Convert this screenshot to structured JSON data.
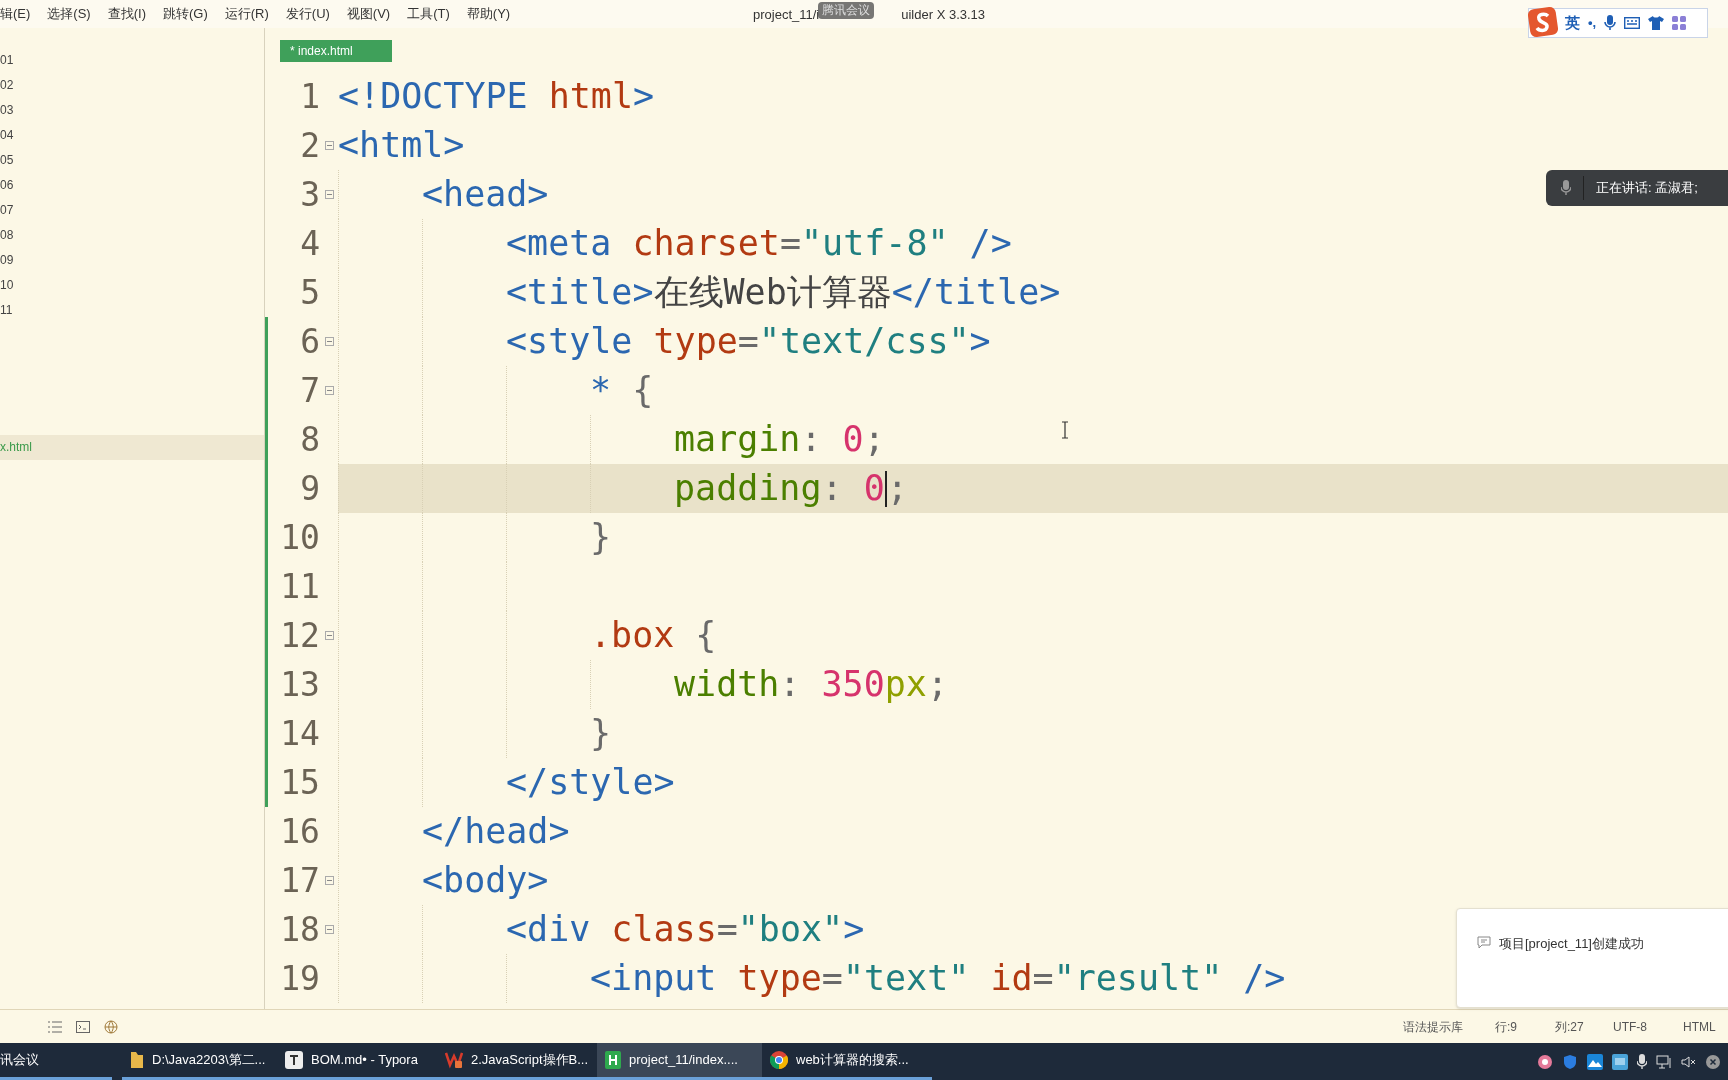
{
  "menu": [
    "辑(E)",
    "选择(S)",
    "查找(I)",
    "跳转(G)",
    "运行(R)",
    "发行(U)",
    "视图(V)",
    "工具(T)",
    "帮助(Y)"
  ],
  "window": {
    "title_start": "project_11/i",
    "title_end": "uilder X 3.3.13",
    "overlay": "腾讯会议"
  },
  "ime_bar": {
    "mode": "英",
    "punct": "•,"
  },
  "sidebar": {
    "items": [
      {
        "label": "01",
        "selected": false
      },
      {
        "label": "02",
        "selected": false
      },
      {
        "label": "03",
        "selected": false
      },
      {
        "label": "04",
        "selected": false
      },
      {
        "label": "05",
        "selected": false
      },
      {
        "label": "06",
        "selected": false
      },
      {
        "label": "07",
        "selected": false
      },
      {
        "label": "08",
        "selected": false
      },
      {
        "label": "09",
        "selected": false
      },
      {
        "label": "10",
        "selected": false
      },
      {
        "label": "11",
        "selected": false
      }
    ],
    "file": {
      "label": "x.html",
      "selected": true
    }
  },
  "tabs": [
    {
      "label": "* index.html",
      "selected": true
    }
  ],
  "speaking": "正在讲话: 孟淑君;",
  "editor": {
    "lines": [
      {
        "n": "1",
        "fold": false,
        "changed": false,
        "current": false,
        "tokens": [
          {
            "t": "<!DOCTYPE ",
            "kind": "tag"
          },
          {
            "t": "html",
            "kind": "attr"
          },
          {
            "t": ">",
            "kind": "tag"
          }
        ]
      },
      {
        "n": "2",
        "fold": true,
        "changed": false,
        "current": false,
        "tokens": [
          {
            "t": "<html>",
            "kind": "tag"
          }
        ],
        "children": [
          {
            "n": "3",
            "fold": true,
            "changed": false,
            "current": false,
            "tokens": [
              {
                "t": "<head>",
                "kind": "tag"
              }
            ],
            "children": [
              {
                "n": "4",
                "fold": false,
                "changed": false,
                "current": false,
                "tokens": [
                  {
                    "t": "<meta ",
                    "kind": "tag"
                  },
                  {
                    "t": "charset",
                    "kind": "attr"
                  },
                  {
                    "t": "=",
                    "kind": "punct"
                  },
                  {
                    "t": "\"utf-8\"",
                    "kind": "string"
                  },
                  {
                    "t": " />",
                    "kind": "tag"
                  }
                ]
              },
              {
                "n": "5",
                "fold": false,
                "changed": false,
                "current": false,
                "tokens": [
                  {
                    "t": "<title>",
                    "kind": "tag"
                  },
                  {
                    "t": "在线Web计算器",
                    "kind": "text"
                  },
                  {
                    "t": "</title>",
                    "kind": "tag"
                  }
                ]
              },
              {
                "n": "6",
                "fold": true,
                "changed": true,
                "current": false,
                "tokens": [
                  {
                    "t": "<style ",
                    "kind": "tag"
                  },
                  {
                    "t": "type",
                    "kind": "attr"
                  },
                  {
                    "t": "=",
                    "kind": "punct"
                  },
                  {
                    "t": "\"text/css\"",
                    "kind": "string"
                  },
                  {
                    "t": ">",
                    "kind": "tag"
                  }
                ],
                "children": [
                  {
                    "n": "7",
                    "fold": true,
                    "changed": true,
                    "current": false,
                    "tokens": [
                      {
                        "t": "*",
                        "kind": "tag"
                      },
                      {
                        "t": " {",
                        "kind": "punct"
                      }
                    ],
                    "children": [
                      {
                        "n": "8",
                        "fold": false,
                        "changed": true,
                        "current": false,
                        "tokens": [
                          {
                            "t": "margin",
                            "kind": "prop"
                          },
                          {
                            "t": ": ",
                            "kind": "punct"
                          },
                          {
                            "t": "0",
                            "kind": "number"
                          },
                          {
                            "t": ";",
                            "kind": "punct"
                          }
                        ]
                      },
                      {
                        "n": "9",
                        "fold": false,
                        "changed": true,
                        "current": true,
                        "tokens": [
                          {
                            "t": "padding",
                            "kind": "prop"
                          },
                          {
                            "t": ": ",
                            "kind": "punct"
                          },
                          {
                            "t": "0",
                            "kind": "number",
                            "caret": true
                          },
                          {
                            "t": ";",
                            "kind": "punct"
                          }
                        ]
                      }
                    ]
                  },
                  {
                    "n": "10",
                    "fold": false,
                    "changed": true,
                    "current": false,
                    "tokens": [
                      {
                        "t": "}",
                        "kind": "punct"
                      }
                    ]
                  },
                  {
                    "n": "11",
                    "fold": false,
                    "changed": true,
                    "current": false
                  },
                  {
                    "n": "12",
                    "fold": true,
                    "changed": true,
                    "current": false,
                    "tokens": [
                      {
                        "t": ".box",
                        "kind": "attr"
                      },
                      {
                        "t": " {",
                        "kind": "punct"
                      }
                    ],
                    "children": [
                      {
                        "n": "13",
                        "fold": false,
                        "changed": true,
                        "current": false,
                        "tokens": [
                          {
                            "t": "width",
                            "kind": "prop"
                          },
                          {
                            "t": ": ",
                            "kind": "punct"
                          },
                          {
                            "t": "350",
                            "kind": "number"
                          },
                          {
                            "t": "px",
                            "kind": "unit"
                          },
                          {
                            "t": ";",
                            "kind": "punct"
                          }
                        ]
                      }
                    ]
                  },
                  {
                    "n": "14",
                    "fold": false,
                    "changed": true,
                    "current": false,
                    "tokens": [
                      {
                        "t": "}",
                        "kind": "punct"
                      }
                    ]
                  }
                ]
              },
              {
                "n": "15",
                "fold": false,
                "changed": true,
                "current": false,
                "tokens": [
                  {
                    "t": "</style>",
                    "kind": "tag"
                  }
                ]
              }
            ]
          },
          {
            "n": "16",
            "fold": false,
            "changed": false,
            "current": false,
            "tokens": [
              {
                "t": "</head>",
                "kind": "tag"
              }
            ]
          },
          {
            "n": "17",
            "fold": true,
            "changed": false,
            "current": false,
            "tokens": [
              {
                "t": "<body>",
                "kind": "tag"
              }
            ],
            "children": [
              {
                "n": "18",
                "fold": true,
                "changed": false,
                "current": false,
                "tokens": [
                  {
                    "t": "<div ",
                    "kind": "tag"
                  },
                  {
                    "t": "class",
                    "kind": "attr"
                  },
                  {
                    "t": "=",
                    "kind": "punct"
                  },
                  {
                    "t": "\"box\"",
                    "kind": "string"
                  },
                  {
                    "t": ">",
                    "kind": "tag"
                  }
                ],
                "children": [
                  {
                    "n": "19",
                    "fold": false,
                    "changed": false,
                    "current": false,
                    "tokens": [
                      {
                        "t": "<input ",
                        "kind": "tag"
                      },
                      {
                        "t": "type",
                        "kind": "attr"
                      },
                      {
                        "t": "=",
                        "kind": "punct"
                      },
                      {
                        "t": "\"text\"",
                        "kind": "string"
                      },
                      {
                        "t": " id",
                        "kind": "attr"
                      },
                      {
                        "t": "=",
                        "kind": "punct"
                      },
                      {
                        "t": "\"result\"",
                        "kind": "string"
                      },
                      {
                        "t": " />",
                        "kind": "tag"
                      }
                    ]
                  }
                ]
              }
            ]
          }
        ]
      }
    ]
  },
  "notification": "项目[project_11]创建成功",
  "status_bar": {
    "items": [
      "语法提示库",
      "行:9",
      "列:27",
      "UTF-8",
      "HTML"
    ]
  },
  "taskbar": [
    {
      "label": "讯会议",
      "selected": false
    },
    {
      "label": "D:\\Java2203\\第二...",
      "selected": false
    },
    {
      "label": "BOM.md• - Typora",
      "selected": false
    },
    {
      "label": "2.JavaScript操作B...",
      "selected": false
    },
    {
      "label": "project_11/index....",
      "selected": true
    },
    {
      "label": "web计算器的搜索...",
      "selected": false
    }
  ]
}
